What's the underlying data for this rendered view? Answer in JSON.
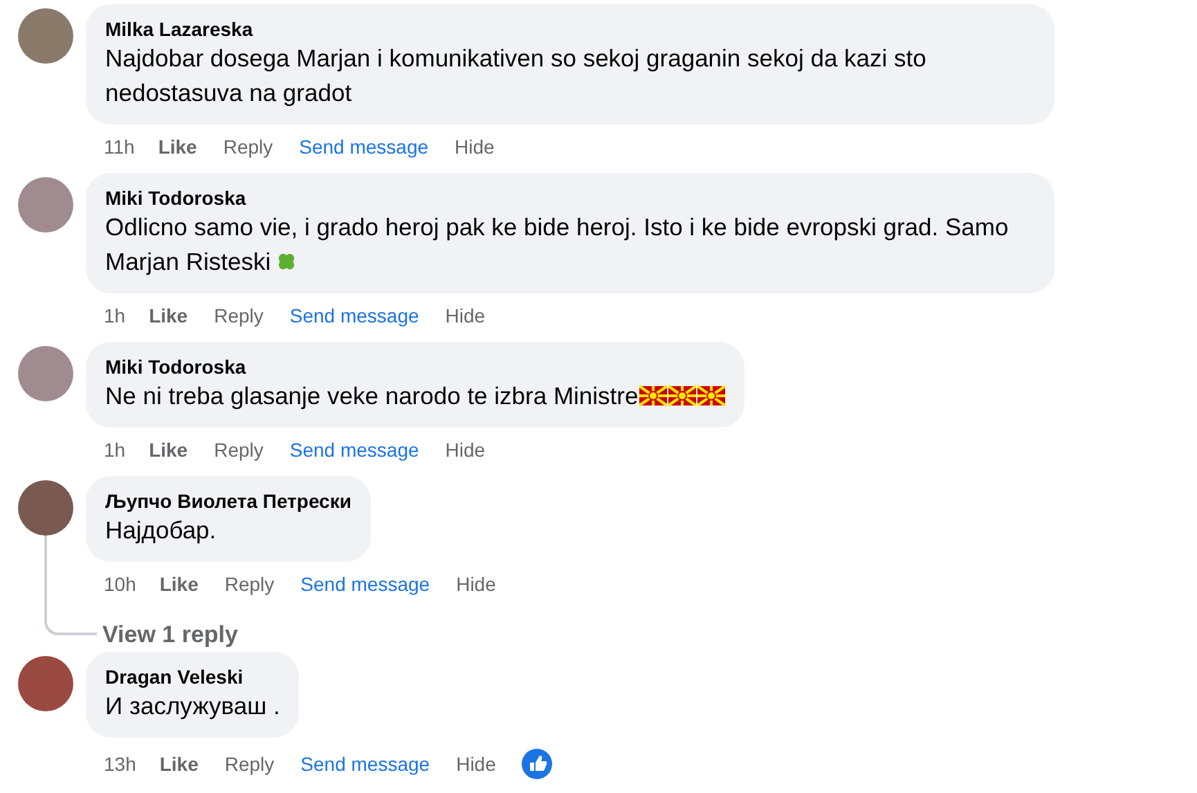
{
  "comments": [
    {
      "author": "Milka Lazareska",
      "text": "Najdobar dosega Marjan i komunikativen so sekoj graganin sekoj da kazi sto nedostasuva na gradot",
      "time": "11h",
      "actions": [
        "Like",
        "Reply",
        "Send message",
        "Hide"
      ],
      "liked": false
    },
    {
      "author": "Miki Todoroska",
      "text": "Odlicno samo vie, i grado heroj pak ke bide heroj. Isto i ke bide evropski grad. Samo Marjan Risteski",
      "emojis": [
        {
          "kind": "clover"
        }
      ],
      "time": "1h",
      "actions": [
        "Like",
        "Reply",
        "Send message",
        "Hide"
      ],
      "liked": false
    },
    {
      "author": "Miki Todoroska",
      "text": "Ne ni treba glasanje veke narodo te izbra Ministre",
      "emojis": [
        {
          "kind": "flag"
        },
        {
          "kind": "flag"
        },
        {
          "kind": "flag"
        }
      ],
      "time": "1h",
      "actions": [
        "Like",
        "Reply",
        "Send message",
        "Hide"
      ],
      "liked": false
    },
    {
      "author": "Љупчо Виолета Петрески",
      "text": "Најдобар.",
      "time": "10h",
      "actions": [
        "Like",
        "Reply",
        "Send message",
        "Hide"
      ],
      "liked": false,
      "replies_link": "View 1 reply"
    },
    {
      "author": "Dragan Veleski",
      "text": "И заслужуваш .",
      "time": "13h",
      "actions": [
        "Like",
        "Reply",
        "Send message",
        "Hide"
      ],
      "liked": true
    }
  ]
}
